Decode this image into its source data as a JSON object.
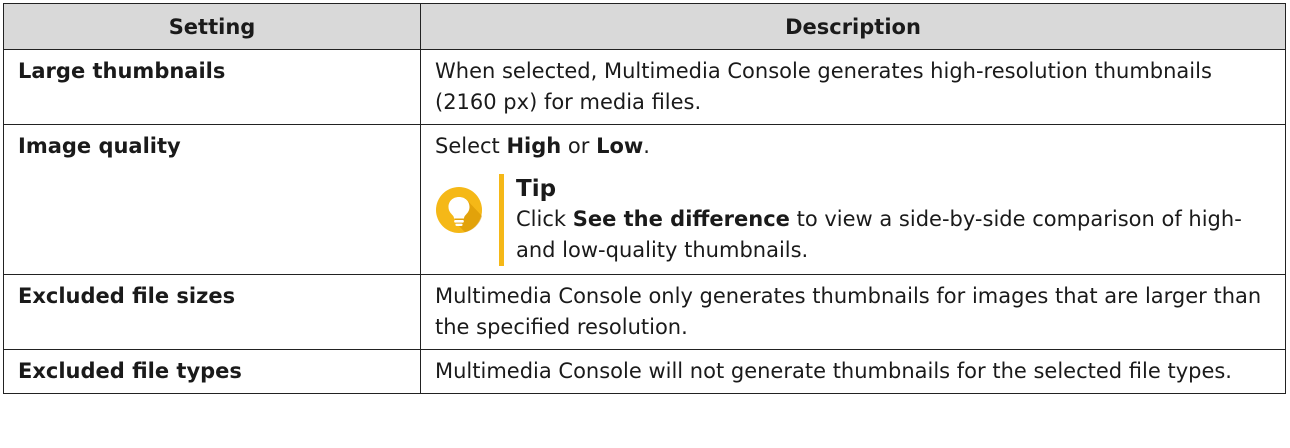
{
  "table": {
    "headers": {
      "setting": "Setting",
      "description": "Description"
    },
    "rows": [
      {
        "setting": "Large thumbnails",
        "description": "When selected, Multimedia Console generates high-resolution thumbnails (2160 px) for media files."
      },
      {
        "setting": "Image quality",
        "description_prefix": "Select ",
        "description_opt1": "High",
        "description_mid": " or ",
        "description_opt2": "Low",
        "description_suffix": ".",
        "tip": {
          "icon": "lightbulb-icon",
          "title": "Tip",
          "text_prefix": "Click ",
          "text_bold": "See the difference",
          "text_suffix": " to view a side-by-side comparison of high- and low-quality thumbnails."
        }
      },
      {
        "setting": "Excluded file sizes",
        "description": "Multimedia Console only generates thumbnails for images that are larger than the specified resolution."
      },
      {
        "setting": "Excluded file types",
        "description": "Multimedia Console will not generate thumbnails for the selected file types."
      }
    ]
  },
  "colors": {
    "header_bg": "#d9d9d9",
    "border": "#222222",
    "tip_accent": "#f5b817",
    "tip_icon_shadow": "#d18f00"
  }
}
